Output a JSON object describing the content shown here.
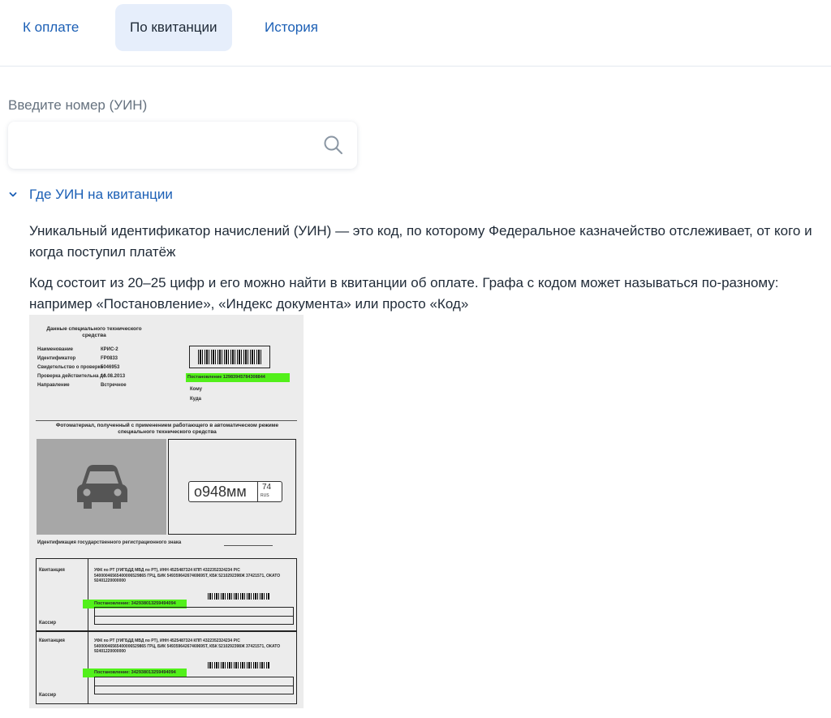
{
  "tabs": [
    {
      "label": "К оплате",
      "active": false
    },
    {
      "label": "По квитанции",
      "active": true
    },
    {
      "label": "История",
      "active": false
    }
  ],
  "search": {
    "label": "Введите номер (УИН)",
    "value": "",
    "placeholder": ""
  },
  "expander": {
    "label": "Где УИН на квитанции",
    "expanded": true
  },
  "info": {
    "p1": "Уникальный идентификатор начислений (УИН) — это код, по которому Федеральное казначейство отслеживает, от кого и когда поступил платёж",
    "p2": "Код состоит из 20–25 цифр и его можно найти в квитанции об оплате. Графа с кодом может называться по-разному: например «Постановление», «Индекс документа» или просто «Код»"
  },
  "receipt": {
    "title": "Данные специального технического средства",
    "rows": [
      {
        "k": "Наименование",
        "v": "КРИС-2"
      },
      {
        "k": "Идентификатор",
        "v": "FP0833"
      },
      {
        "k": "Свидетельство о проверке",
        "v": "5046953"
      },
      {
        "k": "Проверка действительна до",
        "v": "16.08.2013"
      },
      {
        "k": "Направление",
        "v": "Встречное"
      }
    ],
    "postanovlenie_top": "Постановление 12983945784308844",
    "komu": "Кому",
    "kuda": "Куда",
    "photo_title": "Фотоматериал, полученный с применением работающего в автоматическом режиме специального технического средства",
    "plate_number": "о948мм",
    "plate_region": "74",
    "plate_rus": "RUS",
    "ident_title": "Идентификация государственного регистрационного знака",
    "kvitanciya": "Квитанция",
    "kassir": "Кассир",
    "payee": "УФК по РТ (УИГБДД МВД по РТ), ИНН 4525487324 КПП 4322352324234 Р/С 54000046565400006529865 ГРЦ, БИК 54935964267469695Т, КБК 5210292398Ж 37421571, ОКАТО 92401220000000",
    "postanovlenie_bottom": "Постановление: 34293801325949409­4"
  },
  "colors": {
    "accent": "#1b5fb5",
    "active_tab_bg": "#e6eefb",
    "highlight": "#52f01a"
  },
  "icons": {
    "search": "search-icon",
    "chevron": "chevron-down-icon",
    "car": "car-icon"
  }
}
